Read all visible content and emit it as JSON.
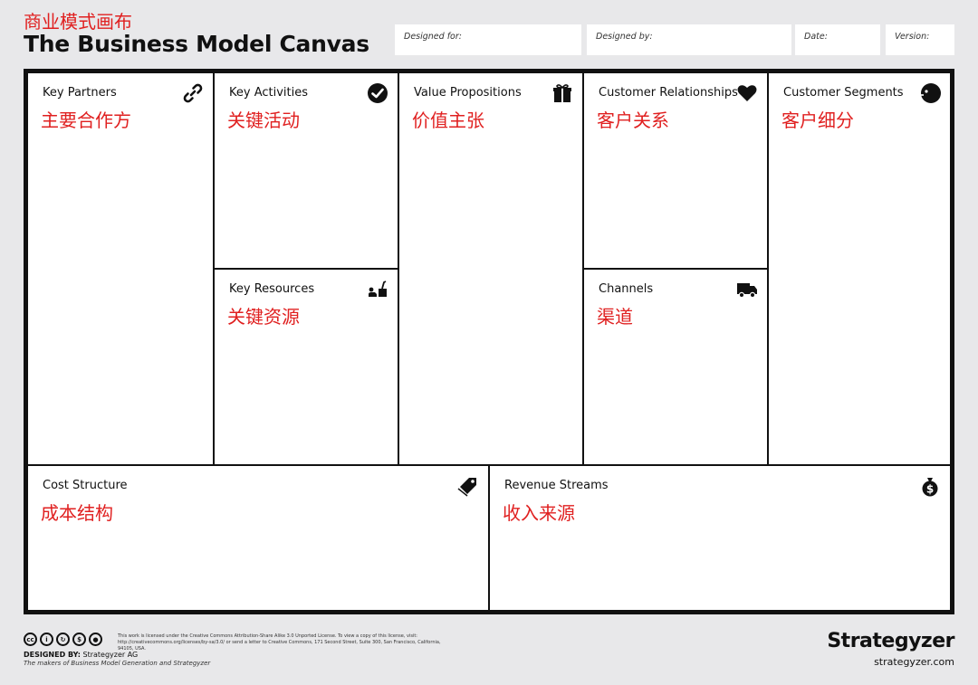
{
  "header": {
    "cn_title": "商业模式画布",
    "title": "The Business Model Canvas",
    "designed_for": "Designed for:",
    "designed_by": "Designed by:",
    "date": "Date:",
    "version": "Version:"
  },
  "cells": {
    "key_partners": {
      "label": "Key Partners",
      "cn": "主要合作方",
      "icon": "link-icon"
    },
    "key_activities": {
      "label": "Key Activities",
      "cn": "关键活动",
      "icon": "check-icon"
    },
    "key_resources": {
      "label": "Key Resources",
      "cn": "关键资源",
      "icon": "worker-icon"
    },
    "value_propositions": {
      "label": "Value Propositions",
      "cn": "价值主张",
      "icon": "gift-icon"
    },
    "customer_relationships": {
      "label": "Customer Relationships",
      "cn": "客户关系",
      "icon": "heart-icon"
    },
    "channels": {
      "label": "Channels",
      "cn": "渠道",
      "icon": "truck-icon"
    },
    "customer_segments": {
      "label": "Customer Segments",
      "cn": "客户细分",
      "icon": "person-head-icon"
    },
    "cost_structure": {
      "label": "Cost Structure",
      "cn": "成本结构",
      "icon": "tag-icon"
    },
    "revenue_streams": {
      "label": "Revenue Streams",
      "cn": "收入来源",
      "icon": "money-bag-icon"
    }
  },
  "footer": {
    "license_text": "This work is licensed under the Creative Commons Attribution-Share Alike 3.0 Unported License. To view a copy of this license, visit: http://creativecommons.org/licenses/by-sa/3.0/ or send a letter to Creative Commons, 171 Second Street, Suite 300, San Francisco, California, 94105, USA.",
    "designed_by_label": "DESIGNED BY:",
    "designed_by_value": " Strategyzer AG",
    "makers": "The makers of Business Model Generation and Strategyzer",
    "brand": "Strategyzer",
    "brand_url": "strategyzer.com"
  },
  "colors": {
    "accent": "#e02020",
    "border": "#111111",
    "background": "#e8e8ea"
  }
}
